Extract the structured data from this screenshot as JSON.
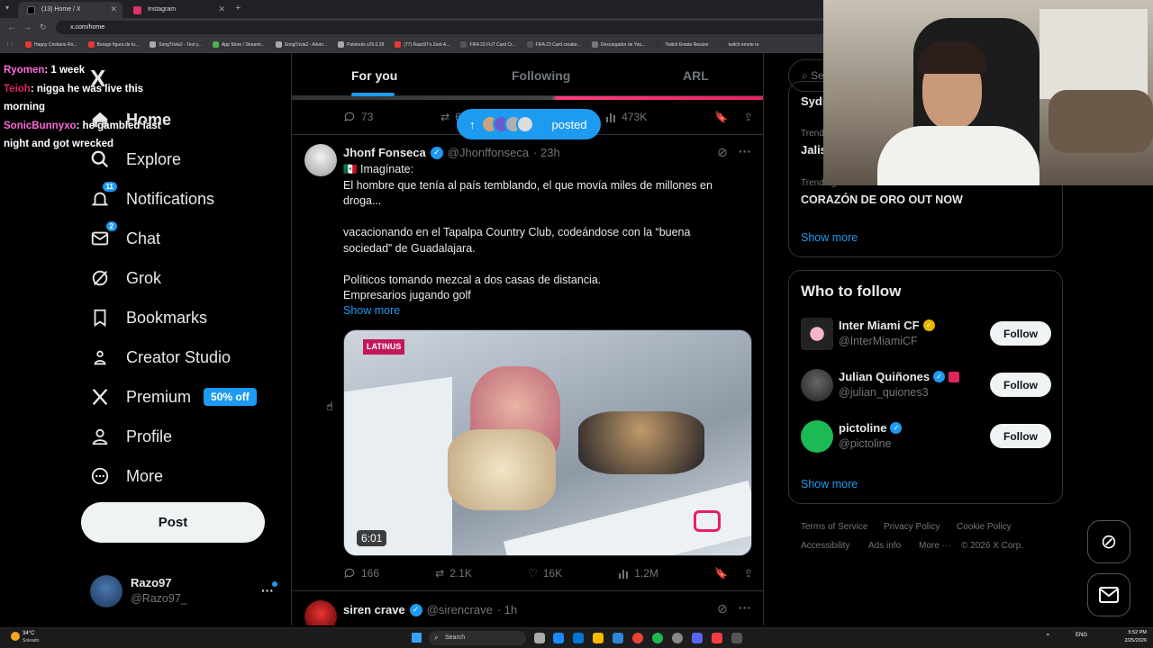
{
  "browser": {
    "tabs": [
      {
        "label": "(13) Home / X"
      },
      {
        "label": "Instagram"
      }
    ],
    "url": "x.com/home",
    "bookmarks": [
      "Happy Cristiano Ro...",
      "Burago figura de to...",
      "SongTrivia2 - Test y...",
      "App Store / Streami...",
      "SongTrivia2 - Advin...",
      "Paletools v26.0.28",
      "(77) Razo97's Zest-A...",
      "FIFA 23 FUT Card Cr...",
      "FIFA 23 Card creator...",
      "Descargador de You...",
      "Twitch Emote Resizer",
      "twitch emote re"
    ]
  },
  "chat": [
    {
      "user": "Ryomen",
      "text": ": 1 week",
      "color": "#ff6bd6"
    },
    {
      "user": "Teioh",
      "text": ": nigga he was live this morning",
      "color": "#e0245e"
    },
    {
      "user": "SonicBunnyxo",
      "text": ": he gambled last night and got wrecked",
      "color": "#ff6bd6"
    }
  ],
  "sidebar": {
    "logo": "X",
    "items": [
      {
        "label": "Home"
      },
      {
        "label": "Explore"
      },
      {
        "label": "Notifications",
        "badge": "11"
      },
      {
        "label": "Chat",
        "badge": "2"
      },
      {
        "label": "Grok"
      },
      {
        "label": "Bookmarks"
      },
      {
        "label": "Creator Studio"
      },
      {
        "label": "Premium",
        "tag": "50% off"
      },
      {
        "label": "Profile"
      },
      {
        "label": "More"
      }
    ],
    "post_label": "Post",
    "account": {
      "name": "Razo97",
      "handle": "@Razo97_"
    }
  },
  "feed": {
    "tabs": [
      "For you",
      "Following",
      "ARL"
    ],
    "new_posts_pill": "posted",
    "prev_tweet_stats": {
      "replies": "73",
      "reposts": "6",
      "views": "473K"
    },
    "tweet1": {
      "name": "Jhonf Fonseca",
      "handle": "@Jhonffonseca",
      "time": "· 23h",
      "lines": [
        "🇲🇽 Imagínate:",
        "El hombre que tenía al país temblando, el que movía miles de millones en droga...",
        "",
        "vacacionando en el Tapalpa Country Club, codeándose con la “buena sociedad” de Guadalajara.",
        "",
        "Políticos tomando mezcal a dos casas de distancia.",
        "Empresarios jugando golf"
      ],
      "show_more": "Show more",
      "video_badge": "LATINUS",
      "duration": "6:01",
      "stats": {
        "replies": "166",
        "reposts": "2.1K",
        "likes": "16K",
        "views": "1.2M"
      }
    },
    "tweet2": {
      "name": "siren crave",
      "handle": "@sirencrave",
      "time": "· 1h"
    }
  },
  "right": {
    "search_placeholder": "Se",
    "trends": [
      {
        "context": "",
        "title": "Sydn"
      },
      {
        "context": "Trend",
        "title": "Jalis"
      },
      {
        "context": "Trending in Mexico",
        "title": "CORAZÓN DE ORO OUT NOW"
      }
    ],
    "trends_show_more": "Show more",
    "who_to_follow": {
      "title": "Who to follow",
      "accounts": [
        {
          "name": "Inter Miami CF",
          "handle": "@InterMiamiCF",
          "btn": "Follow"
        },
        {
          "name": "Julian Quiñones",
          "handle": "@julian_quiones3",
          "btn": "Follow"
        },
        {
          "name": "pictoline",
          "handle": "@pictoline",
          "btn": "Follow"
        }
      ],
      "show_more": "Show more"
    },
    "footer": [
      "Terms of Service",
      "Privacy Policy",
      "Cookie Policy",
      "Accessibility",
      "Ads info",
      "More ···",
      "© 2026 X Corp."
    ]
  },
  "taskbar": {
    "weather": "34°C",
    "weather_desc": "Soleado",
    "search": "Search",
    "lang": "ENG",
    "time": "5:52 PM",
    "date": "2/25/2026"
  }
}
